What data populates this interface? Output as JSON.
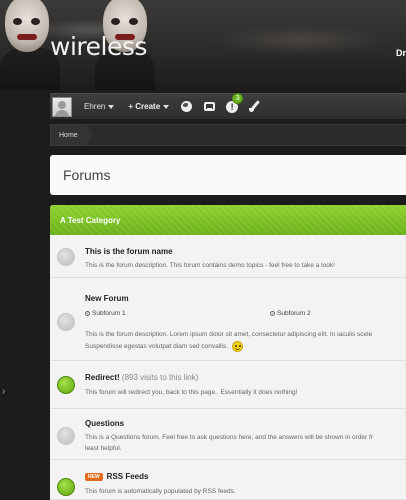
{
  "header": {
    "site_title": "wireless",
    "right_text": "Dr"
  },
  "navbar": {
    "username": "Ehren",
    "create_label": "+ Create",
    "alerts_badge": "3",
    "alert_glyph": "!"
  },
  "breadcrumb": {
    "home": "Home"
  },
  "page": {
    "title": "Forums"
  },
  "category": {
    "title": "A Test Category",
    "nodes": [
      {
        "title": "This is the forum name",
        "desc": "This is the forum description. This forum contains demo topics - feel free to take a look!",
        "icon": "forum-read-icon"
      },
      {
        "title": "New Forum",
        "subforums": [
          "Subforum 1",
          "Subforum 2"
        ],
        "desc_line1": "This is the forum description. Lorem ipsum dolor sit amet, consectetur adipiscing elit. In iaculis scele",
        "desc_line2": "Suspendisse egestas volutpat diam sed convallis.",
        "icon": "forum-read-icon"
      },
      {
        "title": "Redirect!",
        "visits": "(893 visits to this link)",
        "desc": "This forum will redirect you, back to this page.. Essentially it does nothing!",
        "icon": "forum-unread-icon"
      },
      {
        "title": "Questions",
        "desc_line1": "This is a Questions forum. Feel free to ask questions here, and the answers will be shown in order fr",
        "desc_line2": "least helpful.",
        "icon": "forum-read-icon"
      },
      {
        "tag": "NEW",
        "title": "RSS Feeds",
        "desc": "This forum is automatically populated by RSS feeds.",
        "icon": "forum-unread-icon"
      }
    ]
  },
  "colors": {
    "accent": "#6bb11a",
    "tag": "#e26a1b"
  }
}
